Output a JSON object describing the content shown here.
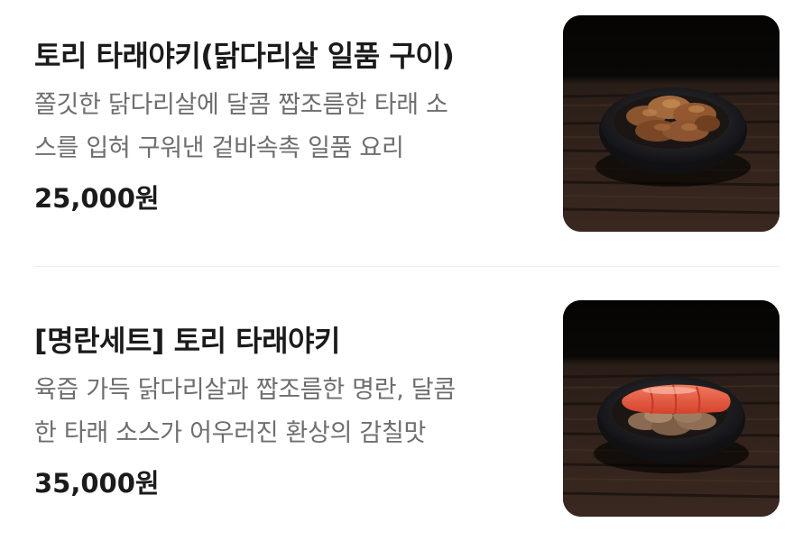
{
  "menu": {
    "items": [
      {
        "name": "토리 타래야키(닭다리살 일품 구이)",
        "description_lines": [
          "쫄깃한 닭다리살에 달콤 짭조름한 타래 소",
          "스를 입혀 구워낸 겉바속촉 일품 요리"
        ],
        "price": "25,000원",
        "photo_icon": "grilled-chicken-dish-photo"
      },
      {
        "name": "[명란세트] 토리 타래야키",
        "description_lines": [
          "육즙 가득 닭다리살과 짭조름한 명란, 달콤",
          "한 타래 소스가 어우러진 환상의 감칠맛"
        ],
        "price": "35,000원",
        "photo_icon": "grilled-chicken-with-mentaiko-photo"
      }
    ]
  },
  "colors": {
    "title": "#1b1b1b",
    "description": "#6e6e6e",
    "divider": "#ececec",
    "photo_background": "#0b0a09"
  }
}
